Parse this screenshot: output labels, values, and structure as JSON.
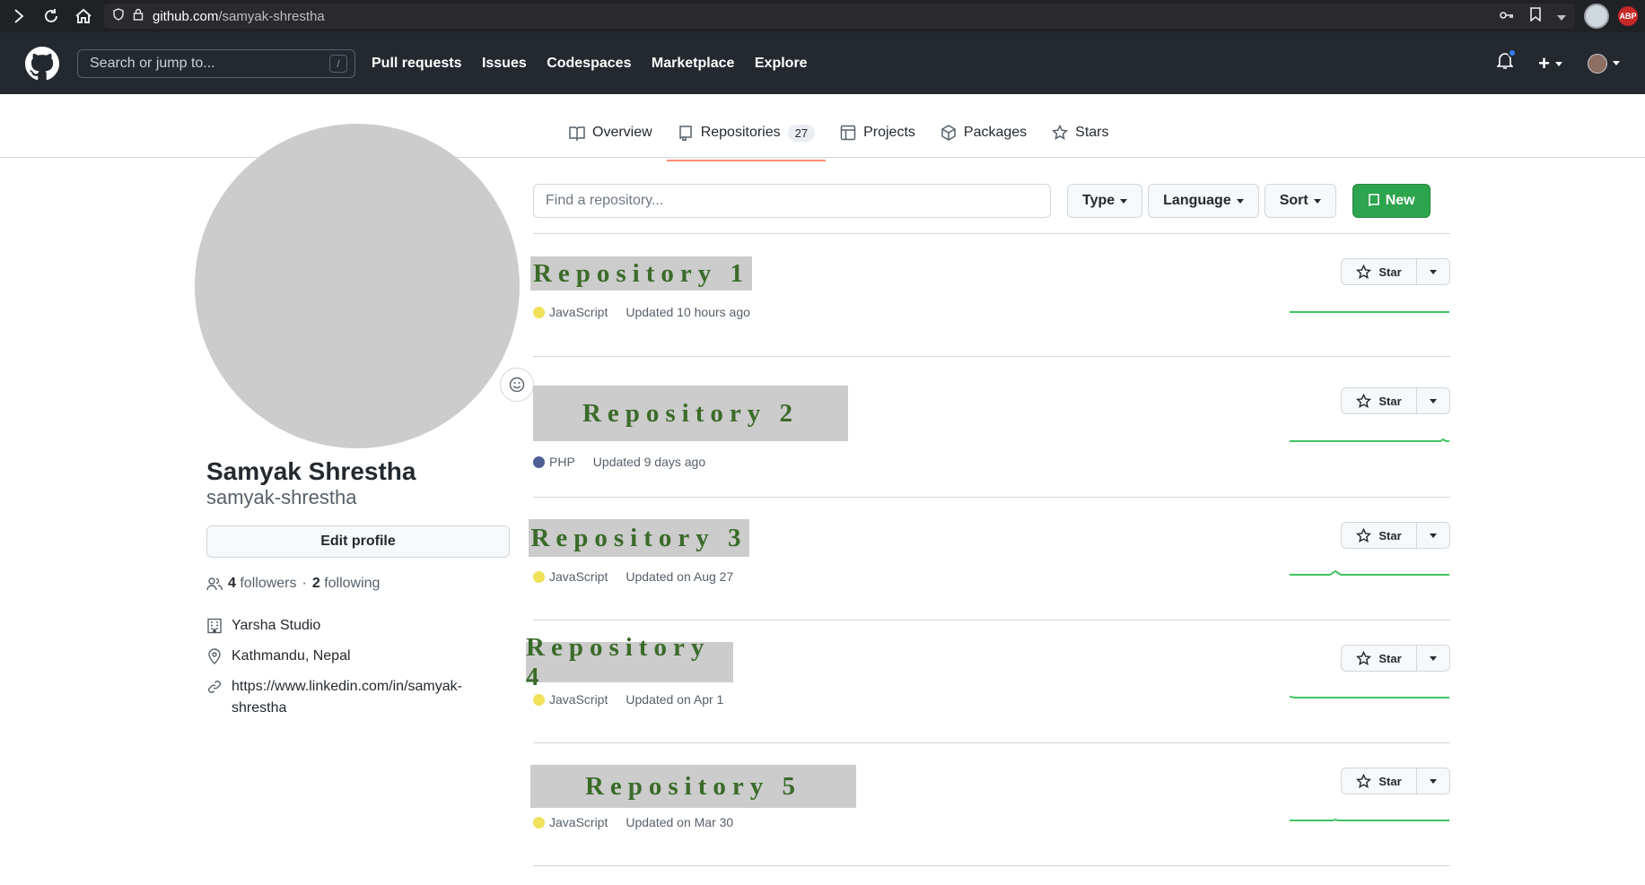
{
  "browser": {
    "url_domain": "github.com",
    "url_path": "/samyak-shrestha",
    "abp_label": "ABP"
  },
  "header": {
    "search_placeholder": "Search or jump to...",
    "search_shortcut": "/",
    "nav": [
      "Pull requests",
      "Issues",
      "Codespaces",
      "Marketplace",
      "Explore"
    ],
    "plus_label": "+"
  },
  "tabs": {
    "overview": "Overview",
    "repositories": "Repositories",
    "repositories_count": "27",
    "projects": "Projects",
    "packages": "Packages",
    "stars": "Stars"
  },
  "profile": {
    "full_name": "Samyak Shrestha",
    "username": "samyak-shrestha",
    "edit_label": "Edit profile",
    "followers_count": "4",
    "followers_label": "followers",
    "separator": "·",
    "following_count": "2",
    "following_label": "following",
    "company": "Yarsha Studio",
    "location": "Kathmandu, Nepal",
    "website_line1": "https://www.linkedin.com/in/samyak-",
    "website_line2": "shrestha"
  },
  "filters": {
    "find_placeholder": "Find a repository...",
    "type": "Type",
    "language": "Language",
    "sort": "Sort",
    "new": "New"
  },
  "repos": [
    {
      "name": "Repository 1",
      "language": "JavaScript",
      "lang_color": "#f1e05a",
      "updated": "Updated 10 hours ago",
      "star": "Star"
    },
    {
      "name": "Repository 2",
      "language": "PHP",
      "lang_color": "#4F5D95",
      "updated": "Updated 9 days ago",
      "star": "Star"
    },
    {
      "name": "Repository 3",
      "language": "JavaScript",
      "lang_color": "#f1e05a",
      "updated": "Updated on Aug 27",
      "star": "Star"
    },
    {
      "name": "Repository 4",
      "language": "JavaScript",
      "lang_color": "#f1e05a",
      "updated": "Updated on Apr 1",
      "star": "Star"
    },
    {
      "name": "Repository 5",
      "language": "JavaScript",
      "lang_color": "#f1e05a",
      "updated": "Updated on Mar 30",
      "star": "Star"
    }
  ],
  "colors": {
    "header_bg": "#24292f",
    "new_button": "#2da44e",
    "tab_underline": "#fd8c73",
    "repo_name_text": "#3b6b2a",
    "sparkline": "#40c463"
  }
}
